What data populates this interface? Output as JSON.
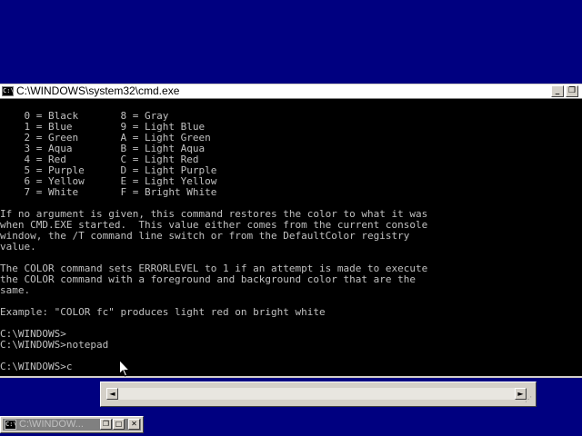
{
  "window": {
    "icon_label": "C:\\",
    "title": "C:\\WINDOWS\\system32\\cmd.exe",
    "buttons": {
      "minimize": "_",
      "restore": "❐",
      "close": "✕"
    }
  },
  "console": {
    "text": "    0 = Black       8 = Gray\n    1 = Blue        9 = Light Blue\n    2 = Green       A = Light Green\n    3 = Aqua        B = Light Aqua\n    4 = Red         C = Light Red\n    5 = Purple      D = Light Purple\n    6 = Yellow      E = Light Yellow\n    7 = White       F = Bright White\n\nIf no argument is given, this command restores the color to what it was\nwhen CMD.EXE started.  This value either comes from the current console\nwindow, the /T command line switch or from the DefaultColor registry\nvalue.\n\nThe COLOR command sets ERRORLEVEL to 1 if an attempt is made to execute\nthe COLOR command with a foreground and background color that are the\nsame.\n\nExample: \"COLOR fc\" produces light red on bright white\n\nC:\\WINDOWS>\nC:\\WINDOWS>notepad\n\nC:\\WINDOWS>c"
  },
  "scrollbar": {
    "left_arrow": "◄",
    "right_arrow": "►",
    "grip": "⋰"
  },
  "minimized_window": {
    "icon_label": "C:\\",
    "title": "C:\\WINDOW...",
    "buttons": {
      "restore": "❐",
      "maximize": "□",
      "close": "✕"
    }
  },
  "icons": {
    "cmd": "cmd-icon",
    "cursor": "mouse-pointer-icon"
  }
}
